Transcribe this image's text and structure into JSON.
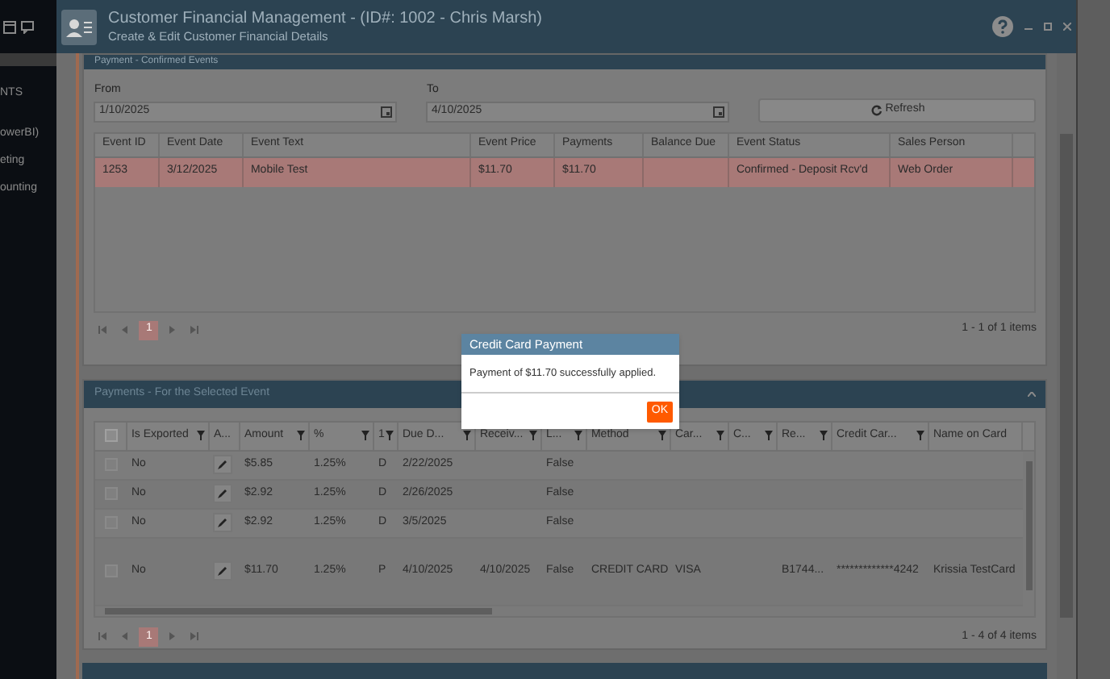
{
  "sidebar": {
    "items": [
      "NTS",
      "owerBI)",
      "eting",
      "ounting"
    ]
  },
  "window": {
    "title": "Customer Financial Management - (ID#: 1002 - Chris Marsh)",
    "subtitle": "Create & Edit Customer Financial Details"
  },
  "events_panel": {
    "title": "Payment - Confirmed Events",
    "from": {
      "label": "From",
      "value": "1/10/2025"
    },
    "to": {
      "label": "To",
      "value": "4/10/2025"
    },
    "refresh": "Refresh",
    "columns": [
      "Event ID",
      "Event Date",
      "Event Text",
      "Event Price",
      "Payments",
      "Balance Due",
      "Event Status",
      "Sales Person"
    ],
    "rows": [
      {
        "cells": [
          "1253",
          "3/12/2025",
          "Mobile Test",
          "$11.70",
          "$11.70",
          "",
          "Confirmed - Deposit Rcv'd",
          "Web Order"
        ],
        "selected": true
      }
    ],
    "page": "1",
    "summary": "1 - 1 of 1 items"
  },
  "payments_panel": {
    "title": "Payments - For the Selected Event",
    "select_all": {
      "checked": false
    },
    "columns": [
      {
        "label": "Is Exported",
        "filter": true
      },
      {
        "label": "A...",
        "filter": false
      },
      {
        "label": "Amount",
        "filter": true
      },
      {
        "label": "%",
        "filter": true
      },
      {
        "label": "1",
        "filter": true
      },
      {
        "label": "Due D...",
        "filter": true
      },
      {
        "label": "Receiv...",
        "filter": true
      },
      {
        "label": "L...",
        "filter": true
      },
      {
        "label": "Method",
        "filter": true
      },
      {
        "label": "Car...",
        "filter": true
      },
      {
        "label": "C...",
        "filter": true
      },
      {
        "label": "Re...",
        "filter": true
      },
      {
        "label": "Credit Car...",
        "filter": true
      },
      {
        "label": "Name on Card",
        "filter": false
      }
    ],
    "rows": [
      {
        "checked": false,
        "cells": [
          "No",
          "",
          "$5.85",
          "1.25%",
          "D",
          "2/22/2025",
          "",
          "False",
          "",
          "",
          "",
          "",
          "",
          ""
        ]
      },
      {
        "checked": false,
        "cells": [
          "No",
          "",
          "$2.92",
          "1.25%",
          "D",
          "2/26/2025",
          "",
          "False",
          "",
          "",
          "",
          "",
          "",
          ""
        ]
      },
      {
        "checked": false,
        "cells": [
          "No",
          "",
          "$2.92",
          "1.25%",
          "D",
          "3/5/2025",
          "",
          "False",
          "",
          "",
          "",
          "",
          "",
          ""
        ]
      },
      {
        "checked": false,
        "cells": [
          "No",
          "",
          "$11.70",
          "1.25%",
          "P",
          "4/10/2025",
          "4/10/2025",
          "False",
          "CREDIT CARD",
          "VISA",
          "",
          "B1744...",
          "*************4242",
          "Krissia TestCard"
        ]
      }
    ],
    "page": "1",
    "summary": "1 - 4 of 4 items"
  },
  "dialog": {
    "title": "Credit Card Payment",
    "message": "Payment of $11.70 successfully applied.",
    "ok": "OK"
  }
}
